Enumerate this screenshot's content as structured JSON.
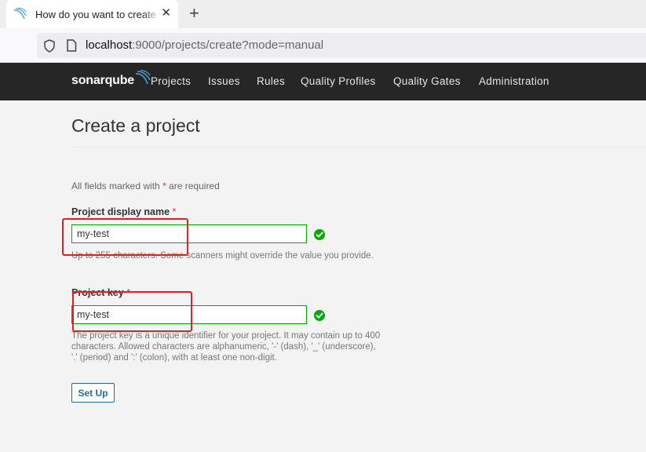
{
  "browser": {
    "tab_title": "How do you want to create your project?",
    "close_glyph": "✕",
    "new_tab_glyph": "+",
    "url_host": "localhost",
    "url_rest": ":9000/projects/create?mode=manual"
  },
  "navbar": {
    "logo_text": "sonarqube",
    "items": [
      {
        "label": "Projects"
      },
      {
        "label": "Issues"
      },
      {
        "label": "Rules"
      },
      {
        "label": "Quality Profiles"
      },
      {
        "label": "Quality Gates"
      },
      {
        "label": "Administration"
      }
    ]
  },
  "page": {
    "title": "Create a project",
    "required_note_prefix": "All fields marked with",
    "required_note_asterisk": "*",
    "required_note_suffix": "are required"
  },
  "form": {
    "display_name": {
      "label": "Project display name",
      "required_mark": "*",
      "value": "my-test",
      "help": "Up to 255 characters. Some scanners might override the value you provide."
    },
    "project_key": {
      "label": "Project key",
      "required_mark": "*",
      "value": "my-test",
      "help": "The project key is a unique identifier for your project. It may contain up to 400 characters. Allowed characters are alphanumeric, '-' (dash), '_' (underscore), '.' (period) and ':' (colon), with at least one non-digit."
    },
    "submit_label": "Set Up"
  },
  "colors": {
    "navbar_bg": "#262626",
    "valid_green": "#00aa00",
    "required_red": "#d4333f",
    "button_blue": "#236a97",
    "annotation_red": "#e51f1f"
  },
  "icons": {
    "tab_favicon": "sonarqube-waves-icon",
    "address_left": "shield-icon",
    "address_page": "page-icon",
    "field_valid": "check-circle-icon"
  }
}
